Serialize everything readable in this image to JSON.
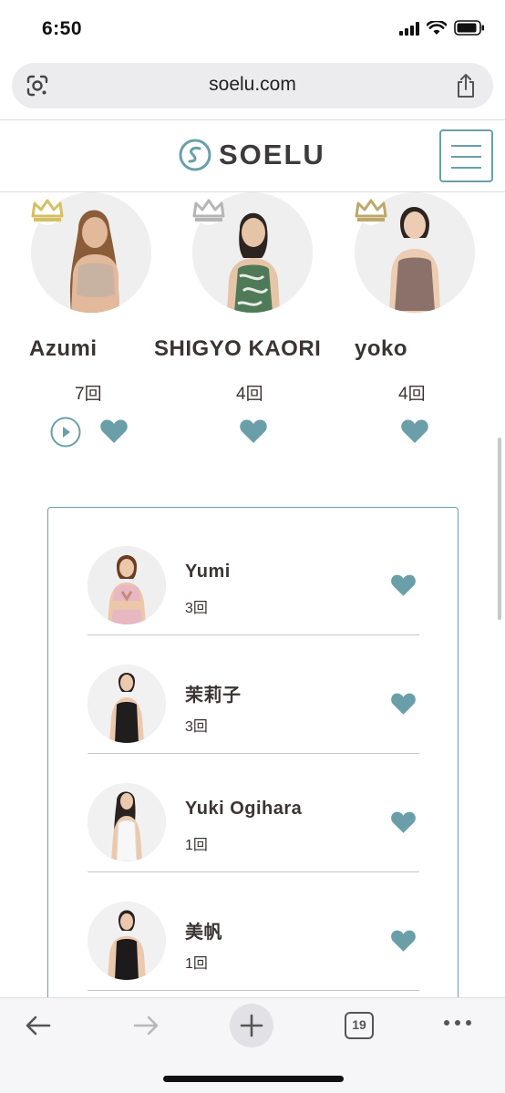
{
  "status_bar": {
    "time": "6:50"
  },
  "browser": {
    "url": "soelu.com",
    "tab_count": "19"
  },
  "site": {
    "logo_text": "SOELU"
  },
  "colors": {
    "accent": "#6a9fa9",
    "gold_crown": "#d4c062",
    "silver_crown": "#b5b5b5",
    "bronze_crown": "#bca86a"
  },
  "top_instructors": [
    {
      "name": "Azumi",
      "count": "7回",
      "crown": "gold"
    },
    {
      "name": "SHIGYO KAORI",
      "count": "4回",
      "crown": "silver"
    },
    {
      "name": "yoko",
      "count": "4回",
      "crown": "bronze"
    }
  ],
  "list_instructors": [
    {
      "name": "Yumi",
      "count": "3回"
    },
    {
      "name": "茉莉子",
      "count": "3回"
    },
    {
      "name": "Yuki Ogihara",
      "count": "1回"
    },
    {
      "name": "美帆",
      "count": "1回"
    }
  ]
}
